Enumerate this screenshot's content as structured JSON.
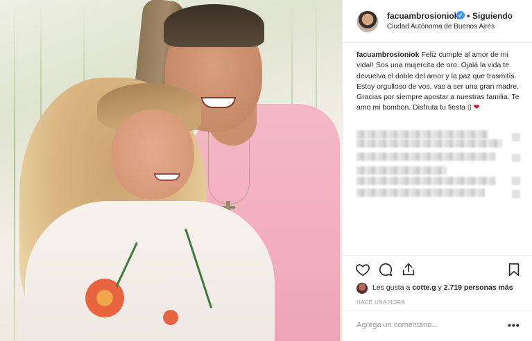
{
  "photo": {
    "alt": "Couple photo",
    "icon": "photo-image"
  },
  "post": {
    "username": "facuambrosioniok",
    "verified_icon": "verified-badge-icon",
    "separator": "•",
    "follow_status": "Siguiendo",
    "location": "Ciudad Autónoma de Buenos Aires"
  },
  "caption": {
    "username": "facuambrosioniok",
    "text": "Feliz cumple al amor de mi vida!! Sos una mujercita de oro. Ojalá la vida te devuelva el doble del amor y la paz que trasmitís. Estoy orgulloso de vos. vas a ser una gran madre. Gracias por siempre apostar a nuestras familia. Te amo mi bombon. Disfruta tu fiesta",
    "emoji": "❤"
  },
  "actions": {
    "like_icon": "heart-icon",
    "comment_icon": "comment-icon",
    "share_icon": "share-icon",
    "save_icon": "bookmark-icon"
  },
  "likes": {
    "prefix": "Les gusta a ",
    "user": "cotte.g",
    "middle": " y ",
    "count": "2.719 personas más"
  },
  "timestamp": "HACE UNA HORA",
  "comment": {
    "placeholder": "Agrega un comentario...",
    "more_label": "•••"
  }
}
